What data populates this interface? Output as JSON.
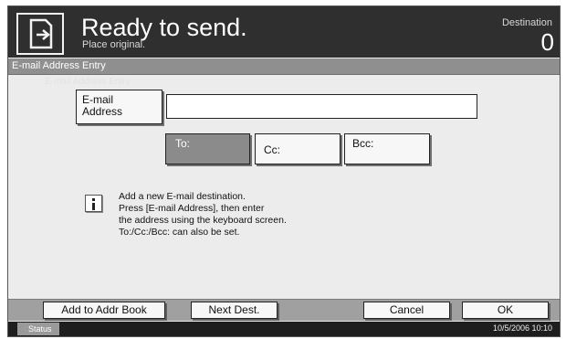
{
  "header": {
    "title": "Ready to send.",
    "subtitle": "Place original.",
    "destination_label": "Destination",
    "destination_count": "0"
  },
  "screen": {
    "title": "E-mail Address Entry",
    "ghost_title": "E-mail Address Entry"
  },
  "email": {
    "button_label": "E-mail\nAddress",
    "input_value": ""
  },
  "recipient_type": {
    "to_label": "To:",
    "cc_label": "Cc:",
    "bcc_label": "Bcc:",
    "selected": "To:"
  },
  "info": {
    "icon": "info-icon",
    "lines": [
      "Add a new E-mail destination.",
      "Press [E-mail Address], then enter",
      "the address using the keyboard screen.",
      "To:/Cc:/Bcc: can also be set."
    ]
  },
  "bottom_bar": {
    "add_to_addr_book": "Add to Addr Book",
    "next_dest": "Next Dest.",
    "cancel": "Cancel",
    "ok": "OK"
  },
  "status": {
    "label": "Status",
    "datetime": "10/5/2006   10:10"
  },
  "colors": {
    "header_bg": "#2f2f2f",
    "selected_button": "#8b8b8b",
    "panel_bg": "#ececec"
  }
}
